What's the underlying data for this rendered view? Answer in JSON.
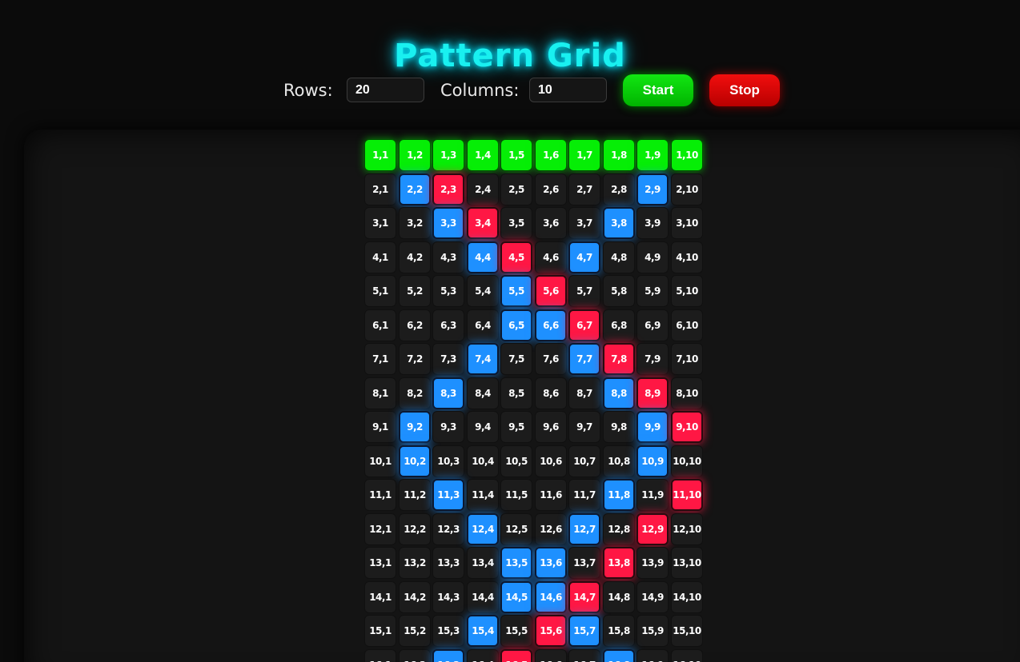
{
  "header": {
    "title": "Pattern Grid"
  },
  "controls": {
    "rows_label": "Rows:",
    "rows_value": "20",
    "columns_label": "Columns:",
    "columns_value": "10",
    "start_label": "Start",
    "stop_label": "Stop"
  },
  "colors": {
    "title_glow": "#00e5ff",
    "start": "#00d000",
    "stop": "#e00000",
    "cell_default": "#1c1c1c",
    "cell_green": "#06ee06",
    "cell_blue": "#1e90ff",
    "cell_red": "#ff1744"
  },
  "grid": {
    "rows": 20,
    "columns": 10,
    "visible_rows": 16,
    "row_states": [
      "GGGGGGGGGG",
      ".BR.....B.",
      "..BR...B..",
      "...BR.B...",
      "....BR....",
      "....BBR...",
      "...B..BR..",
      "..B....BR.",
      ".B......BR",
      ".B......B.",
      "..B....B.R",
      "...B..B.R.",
      "....BB.R..",
      "....BBR...",
      "...B.RB...",
      "..B.R..B.."
    ]
  }
}
